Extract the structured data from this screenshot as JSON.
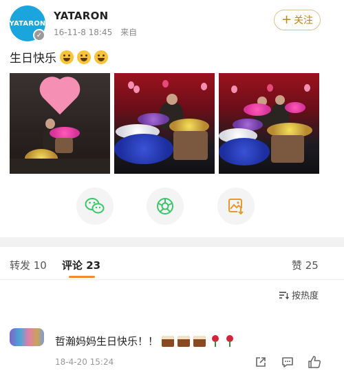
{
  "post": {
    "avatar_text": "YATARON",
    "username": "YATARON",
    "time": "16-11-8 18:45",
    "source": "来自",
    "follow_label": "关注",
    "text": "生日快乐",
    "emoji_count": 3
  },
  "share_actions": [
    {
      "icon": "wechat-icon"
    },
    {
      "icon": "moments-icon"
    },
    {
      "icon": "save-image-icon"
    }
  ],
  "tabs": {
    "repost": "转发 10",
    "comment": "评论 23",
    "like": "赞 25"
  },
  "sort": {
    "label": "按热度"
  },
  "comment": {
    "text": "哲瀚妈妈生日快乐！！",
    "time": "18-4-20 15:24",
    "emoji": [
      "cake",
      "cake",
      "cake",
      "rose",
      "rose"
    ]
  },
  "colors": {
    "accent": "#f08d2a",
    "follow": "#b8860b",
    "avatar": "#1aa6dd",
    "divider": "#f2f2f2"
  }
}
